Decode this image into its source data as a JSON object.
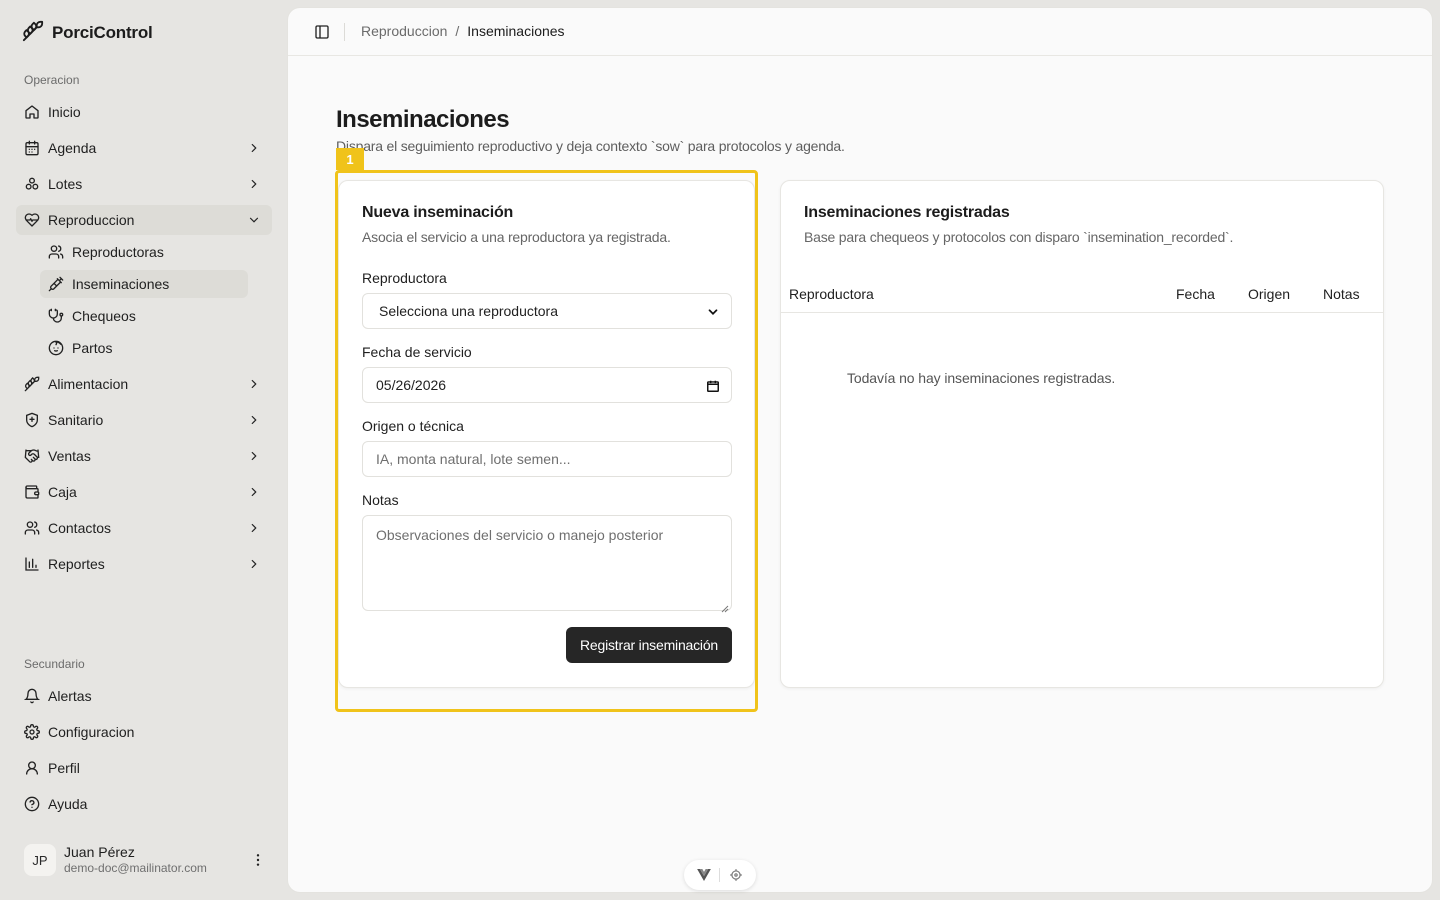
{
  "app": {
    "name": "PorciControl",
    "brand_icon": "leaf-icon"
  },
  "sidebar": {
    "group_operacion": "Operacion",
    "group_secundario": "Secundario",
    "items": [
      {
        "label": "Inicio",
        "icon": "home-icon"
      },
      {
        "label": "Agenda",
        "icon": "calendar-icon"
      },
      {
        "label": "Lotes",
        "icon": "group-icon"
      },
      {
        "label": "Reproduccion",
        "icon": "heart-icon"
      },
      {
        "label": "Alimentacion",
        "icon": "leaf-icon"
      },
      {
        "label": "Sanitario",
        "icon": "shield-icon"
      },
      {
        "label": "Ventas",
        "icon": "handshake-icon"
      },
      {
        "label": "Caja",
        "icon": "wallet-icon"
      },
      {
        "label": "Contactos",
        "icon": "users-icon"
      },
      {
        "label": "Reportes",
        "icon": "chart-icon"
      }
    ],
    "sub_items": [
      {
        "label": "Reproductoras",
        "icon": "users-icon"
      },
      {
        "label": "Inseminaciones",
        "icon": "syringe-icon"
      },
      {
        "label": "Chequeos",
        "icon": "stethoscope-icon"
      },
      {
        "label": "Partos",
        "icon": "baby-icon"
      }
    ],
    "secondary": [
      {
        "label": "Alertas",
        "icon": "bell-icon"
      },
      {
        "label": "Configuracion",
        "icon": "gear-icon"
      },
      {
        "label": "Perfil",
        "icon": "user-icon"
      },
      {
        "label": "Ayuda",
        "icon": "help-icon"
      }
    ],
    "user": {
      "initials": "JP",
      "name": "Juan Pérez",
      "email": "demo-doc@mailinator.com"
    }
  },
  "breadcrumb": {
    "parent": "Reproduccion",
    "separator": "/",
    "current": "Inseminaciones"
  },
  "page": {
    "title": "Inseminaciones",
    "subtitle": "Dispara el seguimiento reproductivo y deja contexto `sow` para protocolos y agenda."
  },
  "highlight": {
    "badge": "1",
    "color": "#f0c31a"
  },
  "form": {
    "title": "Nueva inseminación",
    "description": "Asocia el servicio a una reproductora ya registrada.",
    "reproductora_label": "Reproductora",
    "reproductora_value": "Selecciona una reproductora",
    "fecha_label": "Fecha de servicio",
    "fecha_value": "05/26/2026",
    "origen_label": "Origen o técnica",
    "origen_placeholder": "IA, monta natural, lote semen...",
    "notas_label": "Notas",
    "notas_placeholder": "Observaciones del servicio o manejo posterior",
    "submit_label": "Registrar inseminación"
  },
  "list": {
    "title": "Inseminaciones registradas",
    "description": "Base para chequeos y protocolos con disparo `insemination_recorded`.",
    "columns": [
      "Reproductora",
      "Fecha",
      "Origen",
      "Notas"
    ],
    "empty": "Todavía no hay inseminaciones registradas."
  },
  "colors": {
    "primary_button": "#262626",
    "sidebar_bg": "#e6e5e2"
  }
}
